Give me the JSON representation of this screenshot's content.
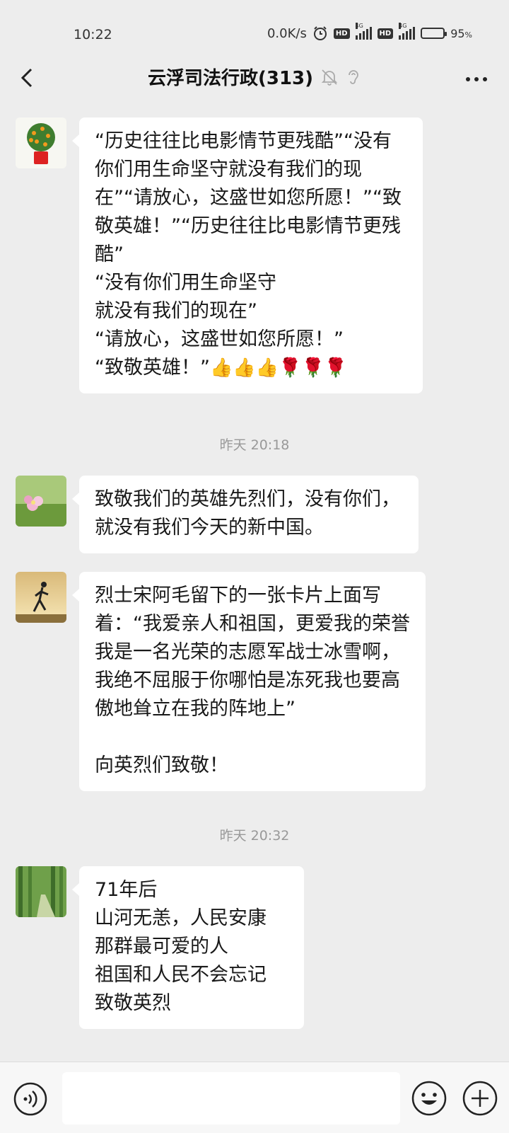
{
  "status_bar": {
    "time": "10:22",
    "speed": "0.0K/s",
    "hd1": "HD",
    "net1": "4G",
    "hd2": "HD",
    "net2": "4G",
    "battery_level": 0.95,
    "battery_pct": "95"
  },
  "nav": {
    "title": "云浮司法行政(313)"
  },
  "messages": [
    {
      "text": "“历史往往比电影情节更残酷”“没有你们用生命坚守就没有我们的现在”“请放心，这盛世如您所愿！”“致敬英雄！”“历史往往比电影情节更残酷”\n“没有你们用生命坚守\n就没有我们的现在”\n“请放心，这盛世如您所愿！”\n“致敬英雄！”",
      "emoji": "👍👍👍🌹🌹🌹"
    },
    {
      "text": "致敬我们的英雄先烈们，没有你们，就没有我们今天的新中国。"
    },
    {
      "text": "烈士宋阿毛留下的一张卡片上面写着：“我爱亲人和祖国，更爱我的荣誉我是一名光荣的志愿军战士冰雪啊，我绝不屈服于你哪怕是冻死我也要高傲地耸立在我的阵地上”\n\n向英烈们致敬！"
    },
    {
      "text": "71年后\n山河无恙，人民安康\n那群最可爱的人\n祖国和人民不会忘记\n致敬英烈"
    }
  ],
  "timestamps": [
    "昨天 20:18",
    "昨天 20:32"
  ],
  "input": {
    "placeholder": ""
  },
  "colors": {
    "background": "#ededed",
    "bubble": "#ffffff",
    "timestamp": "#999999"
  }
}
